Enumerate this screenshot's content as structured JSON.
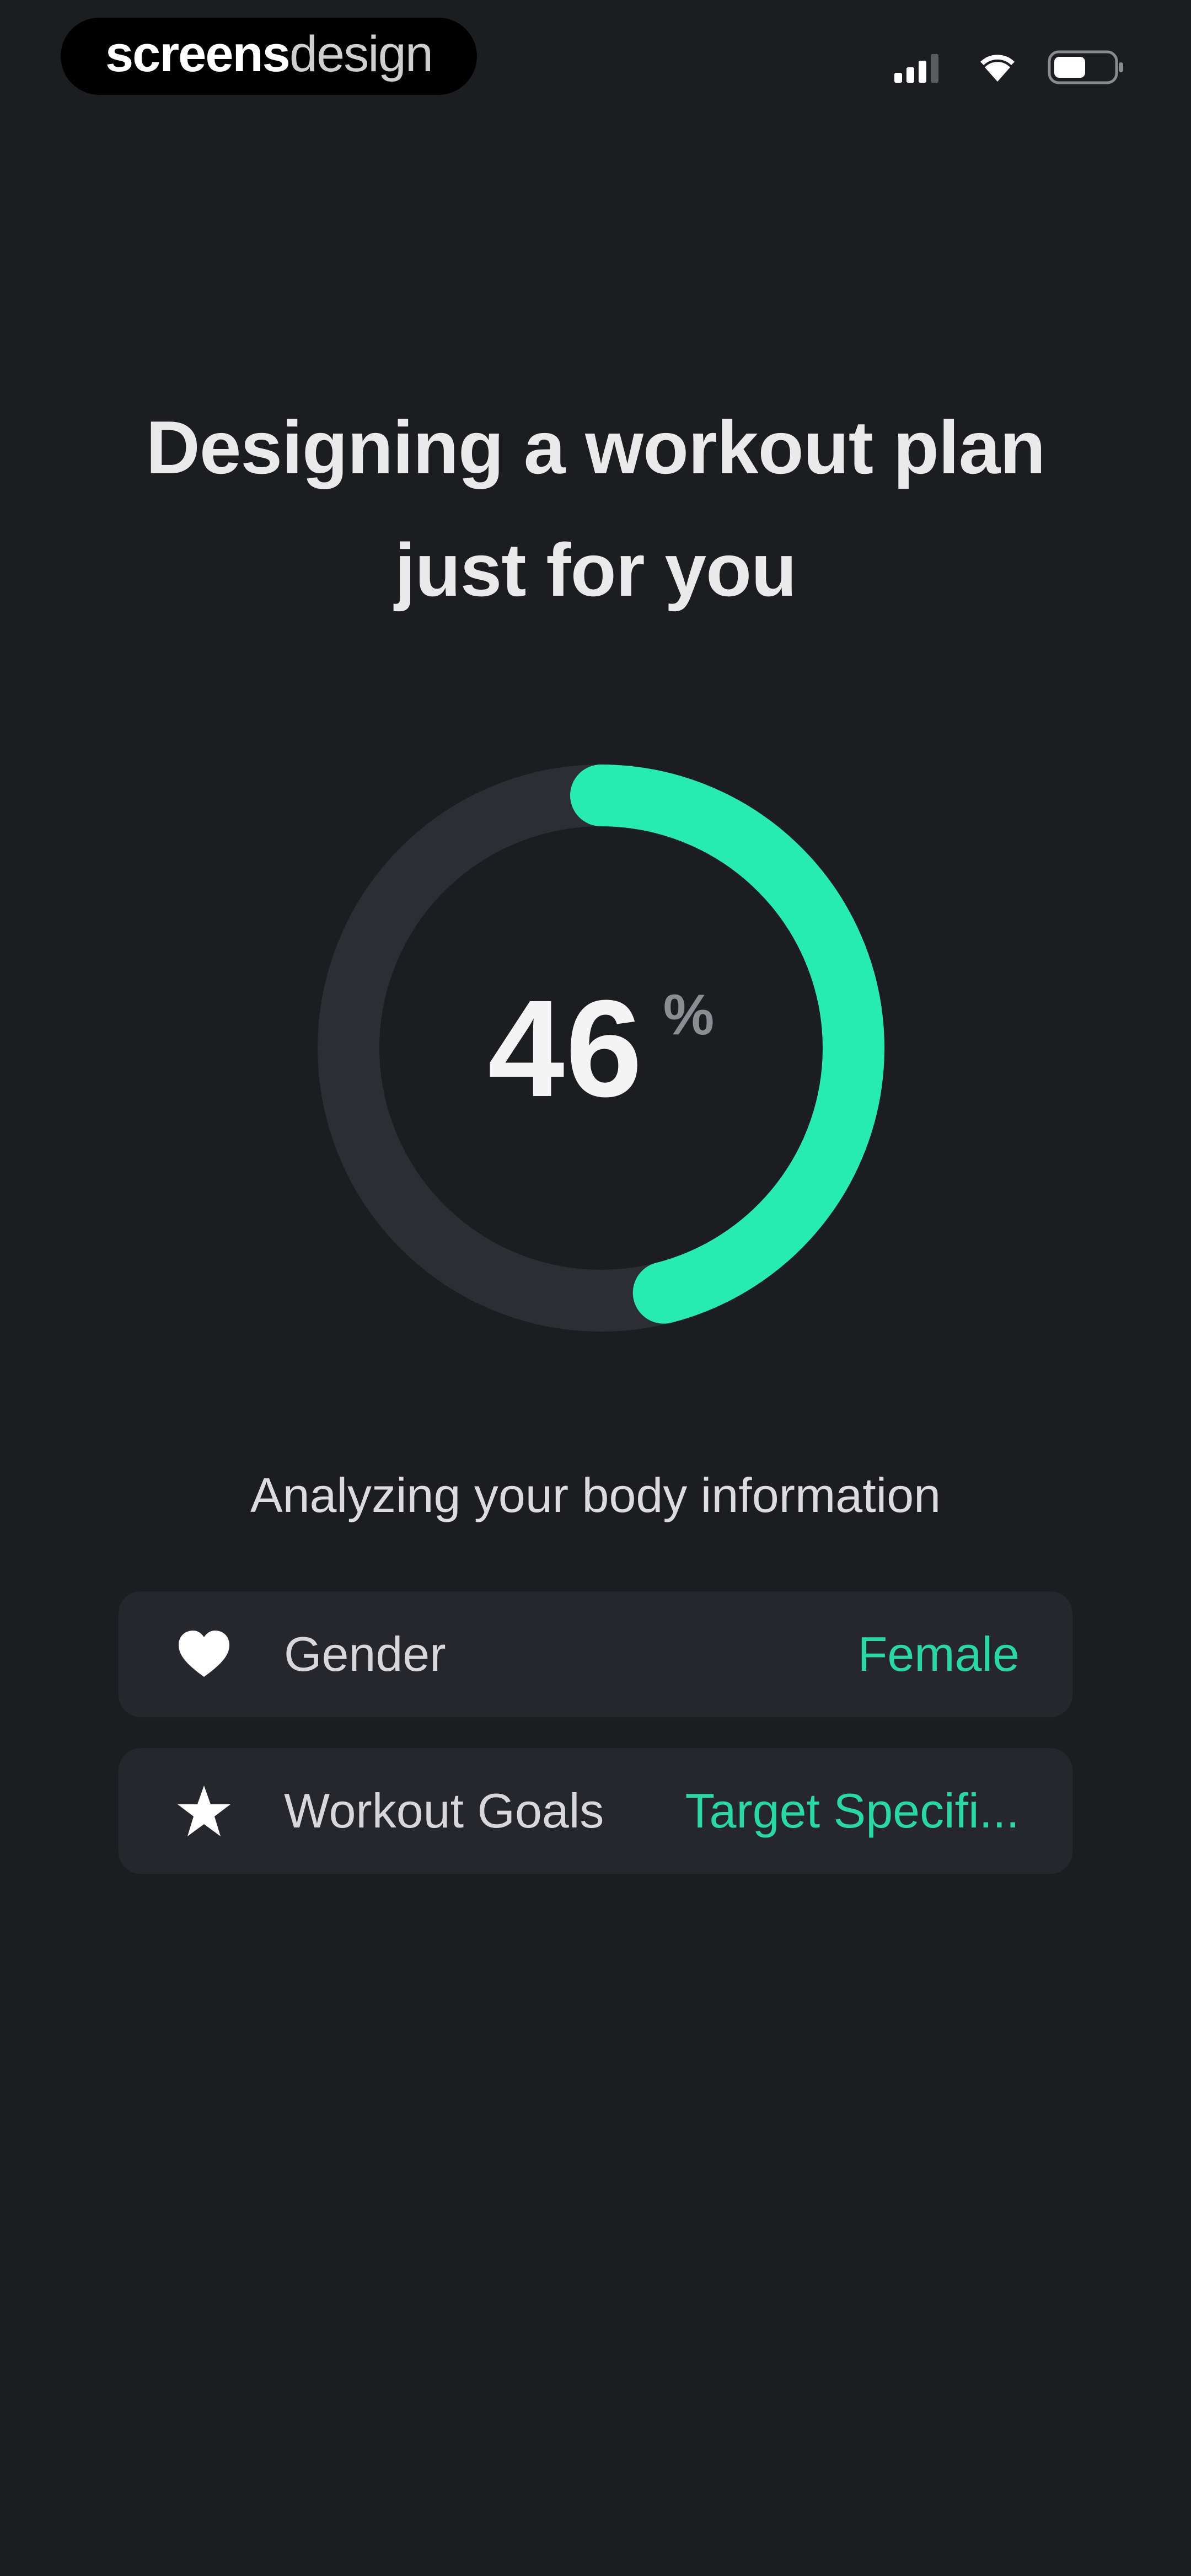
{
  "status_bar": {
    "brand_bold": "screens",
    "brand_light": "design",
    "icons": [
      "signal-icon",
      "wifi-icon",
      "battery-icon"
    ]
  },
  "header": {
    "title_line1": "Designing a workout plan",
    "title_line2": "just for you"
  },
  "progress": {
    "value": 46,
    "display": "46",
    "unit": "%",
    "fraction": 0.46
  },
  "analysis": {
    "caption": "Analyzing your body information",
    "items": [
      {
        "icon": "heart-icon",
        "label": "Gender",
        "value": "Female"
      },
      {
        "icon": "star-icon",
        "label": "Workout Goals",
        "value": "Target Specifi..."
      }
    ]
  },
  "colors": {
    "background": "#1c1d21",
    "card": "#26272c",
    "accent": "#27ecb2",
    "accent_text": "#27d9a4",
    "track": "#2c2e33"
  }
}
